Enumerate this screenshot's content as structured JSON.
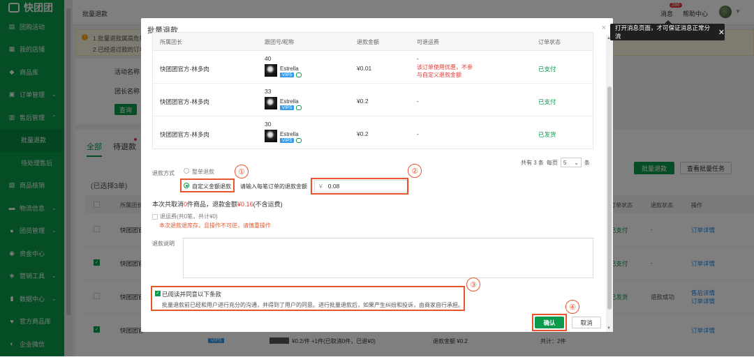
{
  "sidebar": {
    "logo": "快团团",
    "items": [
      {
        "label": "团购活动",
        "icon": "file-icon",
        "chev": ""
      },
      {
        "label": "我的店铺",
        "icon": "store-icon",
        "chev": ""
      },
      {
        "label": "商品库",
        "icon": "box-icon",
        "chev": ""
      },
      {
        "label": "订单管理",
        "icon": "order-icon",
        "chev": "⌄"
      },
      {
        "label": "售后管理",
        "icon": "aftersale-icon",
        "chev": "⌃"
      }
    ],
    "sub": [
      {
        "label": "批量退款",
        "active": true
      },
      {
        "label": "待处理售后",
        "active": false
      }
    ],
    "items2": [
      {
        "label": "商品核销",
        "icon": "verify-icon",
        "chev": ""
      },
      {
        "label": "物流信息",
        "icon": "truck-icon",
        "chev": "⌄"
      },
      {
        "label": "团员管理",
        "icon": "user-icon",
        "chev": "⌄"
      },
      {
        "label": "资金中心",
        "icon": "money-icon",
        "chev": ""
      },
      {
        "label": "营销工具",
        "icon": "tag-icon",
        "chev": "⌄"
      },
      {
        "label": "数据中心",
        "icon": "chart-icon",
        "chev": "⌄"
      },
      {
        "label": "官方商品库",
        "icon": "heart-icon",
        "chev": ""
      },
      {
        "label": "企业微信",
        "icon": "wechat-icon",
        "chev": ""
      }
    ]
  },
  "topbar": {
    "title": "批量退款",
    "messages": "消息",
    "badge": "286",
    "help": "帮助中心",
    "tooltip": "打开消息页面，才可保证消息正常分流"
  },
  "notice": {
    "line1": "1.批量退款属高危操",
    "line2": "2.已经退过款的订单"
  },
  "filter": {
    "activity_label": "活动名称",
    "leader_label": "团长名称",
    "query_button": "查询"
  },
  "list": {
    "tab_all": "全部",
    "tab_pending": "待退款",
    "selected": "(已选择3单)",
    "batch_refund": "批量退款",
    "view_tasks": "查看批量任务",
    "headers": {
      "leader": "所属团长",
      "order_status": "订单状态",
      "refund_status": "退款状态",
      "op": "操作"
    },
    "rows": [
      {
        "name": "快团团官",
        "checked": false,
        "status": "已支付",
        "refund": "-",
        "op": "订单详情"
      },
      {
        "name": "快团团官",
        "checked": true,
        "status": "已支付",
        "refund": "-",
        "op": "订单详情"
      },
      {
        "name": "快团团官",
        "checked": false,
        "status": "已发货",
        "refund": "退款成功",
        "op": "售后详情\n订单详情"
      },
      {
        "name": "快团团官",
        "checked": true,
        "status": "",
        "refund": "",
        "op": "订单详情"
      }
    ],
    "bottom": {
      "vip": "VIP5",
      "price": "¥0.2/件 +1件(已取消0件，已退¥0)",
      "refund_amount": "退款金额 ¥0.2",
      "total": "共计：2件"
    }
  },
  "modal": {
    "title": "批量退款",
    "close": "×",
    "table": {
      "headers": [
        "所属团长",
        "跟团号/昵称",
        "退款金额",
        "可退运费",
        "订单状态"
      ],
      "rows": [
        {
          "leader": "快团团官方-林多肉",
          "num": "40",
          "nick": "Estrella",
          "vip": "VIP5",
          "amount": "¥0.01",
          "shipping": "-",
          "shipping_note": "该订单使用优惠，不参\n与自定义退款金额",
          "status": "已支付"
        },
        {
          "leader": "快团团官方-林多肉",
          "num": "33",
          "nick": "Estrella",
          "vip": "VIP5",
          "amount": "¥0.2",
          "shipping": "-",
          "shipping_note": "",
          "status": "已支付"
        },
        {
          "leader": "快团团官方-林多肉",
          "num": "30",
          "nick": "Estrella",
          "vip": "VIP5",
          "amount": "¥0.2",
          "shipping": "-",
          "shipping_note": "",
          "status": "已发货"
        }
      ]
    },
    "pager": {
      "total": "共有 3 条",
      "per_page": "每页",
      "size": "5",
      "unit": "条"
    },
    "method_label": "退款方式",
    "opt_full": "整单退款",
    "opt_custom": "自定义金额退款",
    "amount_prompt": "请输入每笔订单的退款金额",
    "currency": "¥",
    "amount_value": "0.08",
    "summary_pre": "本次共取消",
    "summary_count": "0",
    "summary_mid": "件商品，退款金额",
    "summary_amount": "¥0.16",
    "summary_post": "(不含运费)",
    "ship_refund": "退运费(共0笔，共计¥0)",
    "warning": "本次退款退库存，且操作不可逆，请慎重操作",
    "remark_label": "退款说明",
    "agree_title": "已阅读并同意以下条款",
    "agree_text": "批量退款前已经和用户进行充分的沟通，并得到了用户的同意。进行批量退款后，如果产生纠纷和投诉，由商家自行承担。",
    "confirm": "确认",
    "cancel": "取消"
  },
  "annotations": {
    "c1": "①",
    "c2": "②",
    "c3": "③",
    "c4": "④"
  },
  "colors": {
    "brand": "#0b9a4b",
    "callout": "#e8552b",
    "alert": "#e53935"
  }
}
